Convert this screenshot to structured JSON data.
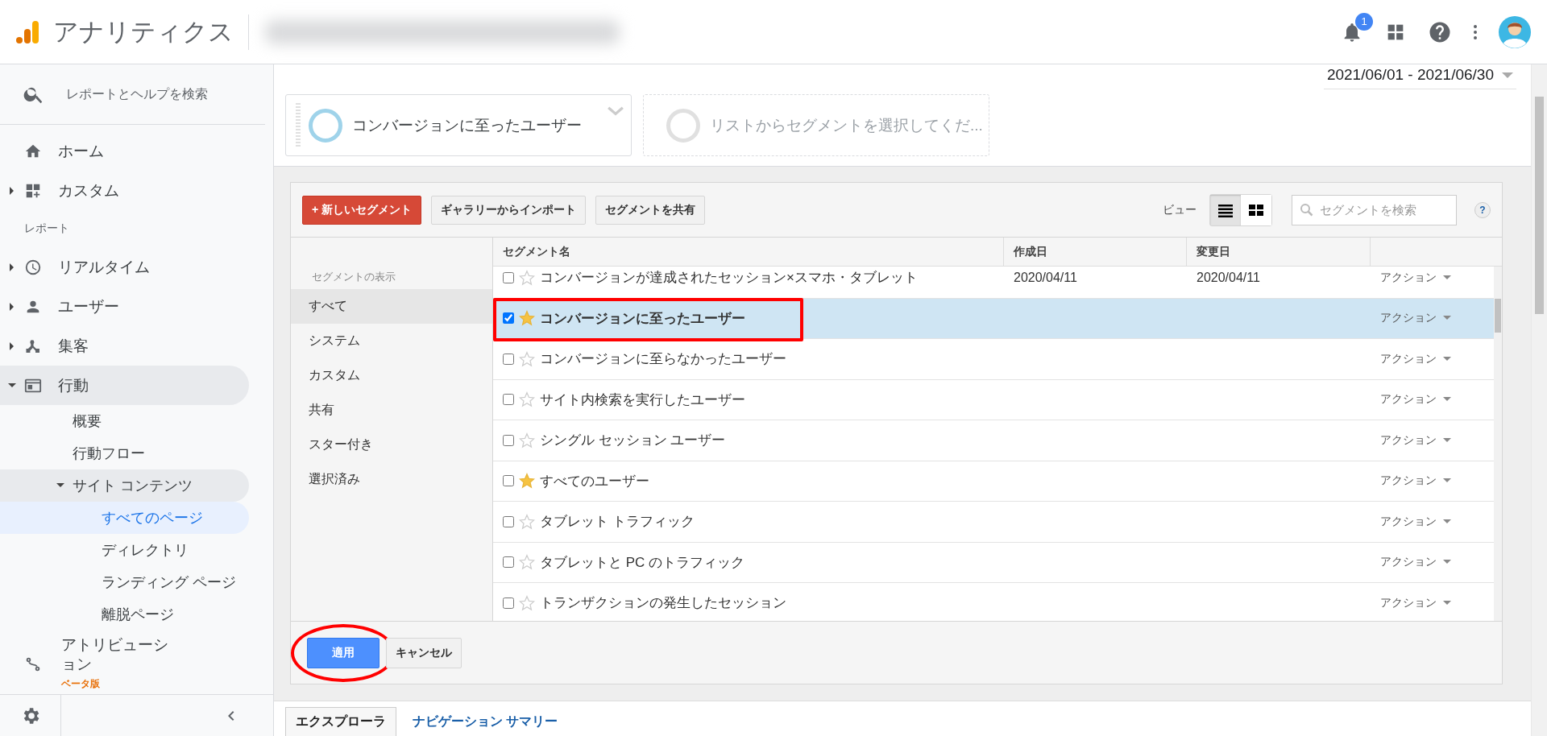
{
  "header": {
    "app_title": "アナリティクス",
    "notification_count": "1"
  },
  "sidebar": {
    "search_placeholder": "レポートとヘルプを検索",
    "items": [
      {
        "kind": "link",
        "label": "ホーム",
        "selected": false
      },
      {
        "kind": "group",
        "label": "カスタム",
        "expanded": false,
        "selected": false
      },
      {
        "kind": "heading",
        "label": "レポート"
      },
      {
        "kind": "group",
        "label": "リアルタイム",
        "expanded": false,
        "selected": false
      },
      {
        "kind": "group",
        "label": "ユーザー",
        "expanded": false,
        "selected": false
      },
      {
        "kind": "group",
        "label": "集客",
        "expanded": false,
        "selected": false
      },
      {
        "kind": "group",
        "label": "行動",
        "expanded": true,
        "selected": false,
        "children": [
          {
            "kind": "link",
            "label": "概要",
            "selected": false
          },
          {
            "kind": "link",
            "label": "行動フロー",
            "selected": false
          },
          {
            "kind": "group",
            "label": "サイト コンテンツ",
            "expanded": true,
            "selected": false,
            "children": [
              {
                "kind": "link",
                "label": "すべてのページ",
                "selected": true
              },
              {
                "kind": "link",
                "label": "ディレクトリ",
                "selected": false
              },
              {
                "kind": "link",
                "label": "ランディング ページ",
                "selected": false
              },
              {
                "kind": "link",
                "label": "離脱ページ",
                "selected": false
              }
            ]
          }
        ]
      },
      {
        "kind": "link",
        "label": "アトリビューション",
        "badge": "ベータ版",
        "selected": false
      }
    ]
  },
  "date_range": "2021/06/01 - 2021/06/30",
  "segment_slots": [
    {
      "kind": "segment",
      "label": "コンバージョンに至ったユーザー"
    },
    {
      "kind": "empty",
      "label": "リストからセグメントを選択してくだ..."
    }
  ],
  "segment_picker": {
    "buttons": [
      {
        "kind": "primary",
        "label": "+ 新しいセグメント"
      },
      {
        "kind": "default",
        "label": "ギャラリーからインポート"
      },
      {
        "kind": "default",
        "label": "セグメントを共有"
      }
    ],
    "view_label": "ビュー",
    "view_modes": [
      {
        "kind": "list",
        "selected": true
      },
      {
        "kind": "grid",
        "selected": false
      }
    ],
    "search_placeholder": "セグメントを検索",
    "help_label": "?",
    "filter_heading": "セグメントの表示",
    "filters": [
      {
        "label": "すべて",
        "selected": true
      },
      {
        "label": "システム",
        "selected": false
      },
      {
        "label": "カスタム",
        "selected": false
      },
      {
        "label": "共有",
        "selected": false
      },
      {
        "label": "スター付き",
        "selected": false
      },
      {
        "label": "選択済み",
        "selected": false
      }
    ],
    "columns": [
      "セグメント名",
      "作成日",
      "変更日"
    ],
    "rows": [
      {
        "name": "コンバージョンが達成されたセッション×スマホ・タブレット",
        "created": "2020/04/11",
        "modified": "2020/04/11",
        "action": "アクション",
        "checked": false,
        "starred": false,
        "selected": false,
        "annotated": false
      },
      {
        "name": "コンバージョンに至ったユーザー",
        "action": "アクション",
        "checked": true,
        "starred": true,
        "selected": true,
        "annotated": true
      },
      {
        "name": "コンバージョンに至らなかったユーザー",
        "action": "アクション",
        "checked": false,
        "starred": false,
        "selected": false,
        "annotated": false
      },
      {
        "name": "サイト内検索を実行したユーザー",
        "action": "アクション",
        "checked": false,
        "starred": false,
        "selected": false,
        "annotated": false
      },
      {
        "name": "シングル セッション ユーザー",
        "action": "アクション",
        "checked": false,
        "starred": false,
        "selected": false,
        "annotated": false
      },
      {
        "name": "すべてのユーザー",
        "action": "アクション",
        "checked": false,
        "starred": true,
        "selected": false,
        "annotated": false
      },
      {
        "name": "タブレット トラフィック",
        "action": "アクション",
        "checked": false,
        "starred": false,
        "selected": false,
        "annotated": false
      },
      {
        "name": "タブレットと PC のトラフィック",
        "action": "アクション",
        "checked": false,
        "starred": false,
        "selected": false,
        "annotated": false
      },
      {
        "name": "トランザクションの発生したセッション",
        "action": "アクション",
        "checked": false,
        "starred": false,
        "selected": false,
        "annotated": false
      }
    ],
    "footer_buttons": [
      {
        "kind": "primary",
        "label": "適用",
        "annotated": true
      },
      {
        "kind": "default",
        "label": "キャンセル",
        "annotated": false
      }
    ]
  },
  "bottom_tabs": [
    {
      "label": "エクスプローラ",
      "selected": true
    },
    {
      "label": "ナビゲーション サマリー",
      "selected": false
    }
  ]
}
